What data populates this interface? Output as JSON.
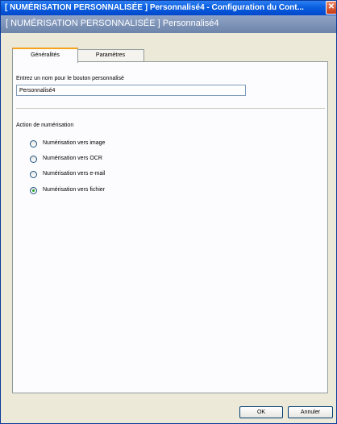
{
  "window": {
    "title": "[ NUMÉRISATION PERSONNALISÉE ]  Personnalisé4 - Configuration du Cont...",
    "close_glyph": "✕"
  },
  "header": {
    "title": "[ NUMÉRISATION PERSONNALISÉE ]  Personnalisé4"
  },
  "tabs": [
    {
      "label": "Généralités",
      "active": true
    },
    {
      "label": "Paramètres",
      "active": false
    }
  ],
  "form": {
    "name_label": "Entrez un nom pour le bouton personnalisé",
    "name_value": "Personnalisé4",
    "action_label": "Action de numérisation",
    "options": [
      {
        "label": "Numérisation vers image",
        "selected": false
      },
      {
        "label": "Numérisation vers OCR",
        "selected": false
      },
      {
        "label": "Numérisation vers e-mail",
        "selected": false
      },
      {
        "label": "Numérisation vers fichier",
        "selected": true
      }
    ]
  },
  "buttons": {
    "ok": "OK",
    "cancel": "Annuler"
  }
}
